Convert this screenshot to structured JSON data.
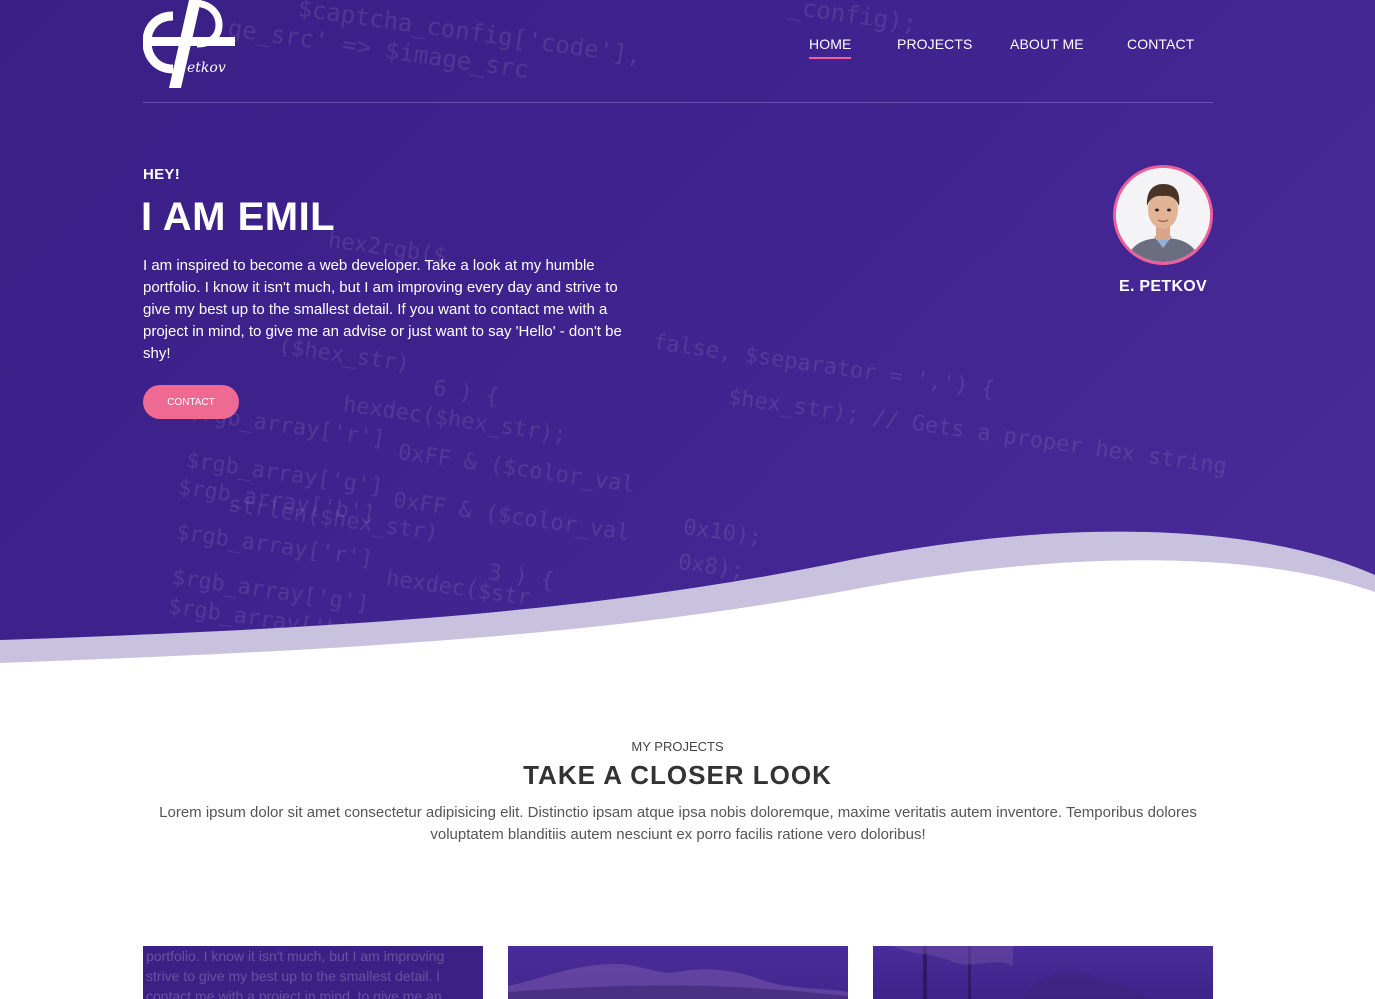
{
  "brand": {
    "logo_text": "etkov",
    "logo_letter": "P"
  },
  "nav": {
    "items": [
      {
        "label": "HOME",
        "active": true
      },
      {
        "label": "PROJECTS",
        "active": false
      },
      {
        "label": "ABOUT ME",
        "active": false
      },
      {
        "label": "CONTACT",
        "active": false
      }
    ]
  },
  "hero": {
    "greeting": "HEY!",
    "title": "I AM EMIL",
    "intro": "I am inspired to become a web developer. Take a look at my humble portfolio. I know it isn't much, but I am improving every day and strive to give my best up to the smallest detail. If you want to contact me with a project in mind, to give me an advise or just want to say 'Hello' - don't be shy!",
    "cta_label": "CONTACT",
    "profile_name": "E. PETKOV"
  },
  "code_background": [
    "$captcha_config['code'],",
    "ge_src'  => $image_src",
    "_config);",
    "hex2rgb($",
    "($hex_str)",
    "6 ) {",
    "hexdec($hex_str);",
    "0xFF & ($color_val",
    "0xFF & ($color_val",
    "0x10);",
    "0x8);",
    "strlen($hex_str)",
    "3 ) {",
    "hexdec($str",
    "false, $separator = ',') {",
    "$hex_str); // Gets a proper hex string",
    "$rgb_array['r']",
    "$rgb_array['g']",
    "$rgb_array['b']",
    "$rgb_array['r']",
    "$rgb_array['g']",
    "$rgb_array['b']"
  ],
  "projects": {
    "subtitle": "MY PROJECTS",
    "title": "TAKE A CLOSER LOOK",
    "description": "Lorem ipsum dolor sit amet consectetur adipisicing elit. Distinctio ipsam atque ipsa nobis doloremque, maxime veritatis autem inventore. Temporibus dolores voluptatem blanditiis autem nesciunt ex porro facilis ratione vero doloribus!",
    "card1_ghost_lines": [
      "portfolio. I know it isn't much, but I am improving",
      "strive to give my best up to the smallest detail. I",
      "contact me with a project in mind, to give me an"
    ]
  },
  "colors": {
    "hero_bg": "#3f238e",
    "accent_pink": "#ee5f9b",
    "button_pink": "#ee6a93",
    "wave_shadow": "#c9c2df"
  },
  "icons": [
    "logo-icon",
    "avatar-photo"
  ]
}
